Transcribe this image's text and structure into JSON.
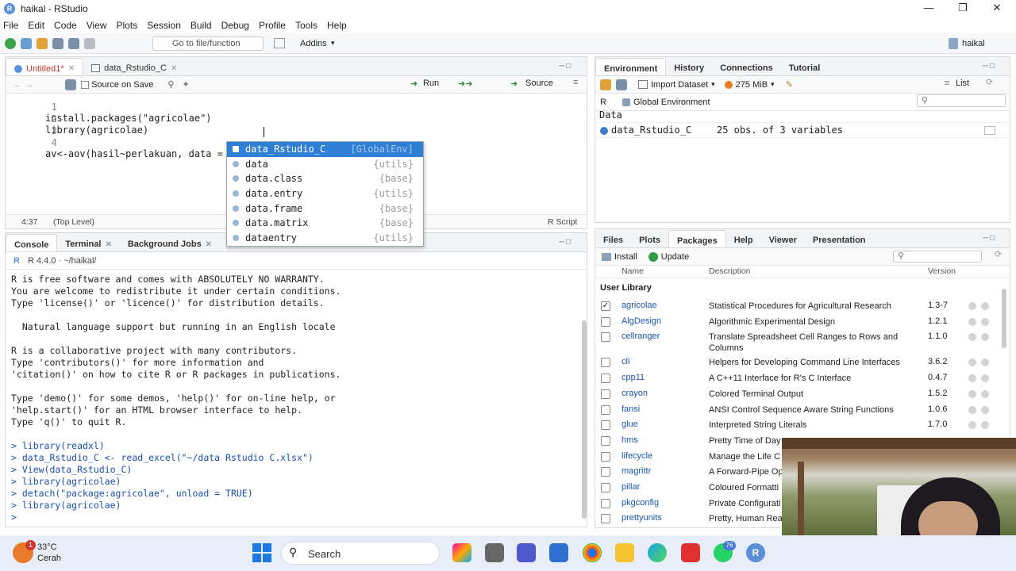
{
  "window": {
    "title": "haikal - RStudio",
    "app_icon": "R"
  },
  "menu": [
    "File",
    "Edit",
    "Code",
    "View",
    "Plots",
    "Session",
    "Build",
    "Debug",
    "Profile",
    "Tools",
    "Help"
  ],
  "toolbar": {
    "goto_placeholder": "Go to file/function",
    "addins": "Addins",
    "user": "haikal"
  },
  "editor": {
    "tabs": [
      {
        "label": "Untitled1*"
      },
      {
        "label": "data_Rstudio_C"
      }
    ],
    "source_on_save": "Source on Save",
    "run": "Run",
    "source": "Source",
    "lines": [
      {
        "num": "1",
        "text": "install.packages(\"agricolae\")"
      },
      {
        "num": "2",
        "text": "library(agricolae)"
      },
      {
        "num": "3",
        "text": ""
      },
      {
        "num": "4",
        "text": "av<-aov(hasil~perlakuan, data = data"
      }
    ],
    "status": {
      "position": "4:37",
      "scope": "(Top Level)",
      "filetype": "R Script"
    }
  },
  "autocomplete": [
    {
      "name": "data_Rstudio_C",
      "source": "[GlobalEnv]",
      "selected": true
    },
    {
      "name": "data",
      "source": "{utils}"
    },
    {
      "name": "data.class",
      "source": "{base}"
    },
    {
      "name": "data.entry",
      "source": "{utils}"
    },
    {
      "name": "data.frame",
      "source": "{base}"
    },
    {
      "name": "data.matrix",
      "source": "{base}"
    },
    {
      "name": "dataentry",
      "source": "{utils}"
    }
  ],
  "console": {
    "tabs": [
      {
        "label": "Console"
      },
      {
        "label": "Terminal"
      },
      {
        "label": "Background Jobs"
      }
    ],
    "version": "R 4.4.0 · ~/haikal/",
    "lines": [
      {
        "text": "R is free software and comes with ABSOLUTELY NO WARRANTY."
      },
      {
        "text": "You are welcome to redistribute it under certain conditions."
      },
      {
        "text": "Type 'license()' or 'licence()' for distribution details."
      },
      {
        "text": ""
      },
      {
        "text": "  Natural language support but running in an English locale"
      },
      {
        "text": ""
      },
      {
        "text": "R is a collaborative project with many contributors."
      },
      {
        "text": "Type 'contributors()' for more information and"
      },
      {
        "text": "'citation()' on how to cite R or R packages in publications."
      },
      {
        "text": ""
      },
      {
        "text": "Type 'demo()' for some demos, 'help()' for on-line help, or"
      },
      {
        "text": "'help.start()' for an HTML browser interface to help."
      },
      {
        "text": "Type 'q()' to quit R."
      },
      {
        "text": ""
      },
      {
        "text": "> library(readxl)"
      },
      {
        "text": "> data_Rstudio_C <- read_excel(\"~/data Rstudio C.xlsx\")"
      },
      {
        "text": "> View(data_Rstudio_C)"
      },
      {
        "text": "> library(agricolae)"
      },
      {
        "text": "> detach(\"package:agricolae\", unload = TRUE)"
      },
      {
        "text": "> library(agricolae)"
      },
      {
        "text": "> "
      }
    ]
  },
  "environment": {
    "tabs": [
      {
        "label": "Environment"
      },
      {
        "label": "History"
      },
      {
        "label": "Connections"
      },
      {
        "label": "Tutorial"
      }
    ],
    "import": "Import Dataset",
    "memory": "275 MiB",
    "list": "List",
    "lang": "R",
    "scope": "Global Environment",
    "section": "Data",
    "items": [
      {
        "name": "data_Rstudio_C",
        "desc": "25 obs. of 3 variables"
      }
    ]
  },
  "packages": {
    "tabs": [
      {
        "label": "Files"
      },
      {
        "label": "Plots"
      },
      {
        "label": "Packages"
      },
      {
        "label": "Help"
      },
      {
        "label": "Viewer"
      },
      {
        "label": "Presentation"
      }
    ],
    "install": "Install",
    "update": "Update",
    "headers": {
      "name": "Name",
      "desc": "Description",
      "ver": "Version"
    },
    "section": "User Library",
    "rows": [
      {
        "checked": true,
        "name": "agricolae",
        "desc": "Statistical Procedures for Agricultural Research",
        "ver": "1.3-7"
      },
      {
        "checked": false,
        "name": "AlgDesign",
        "desc": "Algorithmic Experimental Design",
        "ver": "1.2.1"
      },
      {
        "checked": false,
        "name": "cellranger",
        "desc": "Translate Spreadsheet Cell Ranges to Rows and Columns",
        "ver": "1.1.0"
      },
      {
        "checked": false,
        "name": "cli",
        "desc": "Helpers for Developing Command Line Interfaces",
        "ver": "3.6.2"
      },
      {
        "checked": false,
        "name": "cpp11",
        "desc": "A C++11 Interface for R's C Interface",
        "ver": "0.4.7"
      },
      {
        "checked": false,
        "name": "crayon",
        "desc": "Colored Terminal Output",
        "ver": "1.5.2"
      },
      {
        "checked": false,
        "name": "fansi",
        "desc": "ANSI Control Sequence Aware String Functions",
        "ver": "1.0.6"
      },
      {
        "checked": false,
        "name": "glue",
        "desc": "Interpreted String Literals",
        "ver": "1.7.0"
      },
      {
        "checked": false,
        "name": "hms",
        "desc": "Pretty Time of Day",
        "ver": ""
      },
      {
        "checked": false,
        "name": "lifecycle",
        "desc": "Manage the Life C",
        "ver": ""
      },
      {
        "checked": false,
        "name": "magrittr",
        "desc": "A Forward-Pipe Op",
        "ver": ""
      },
      {
        "checked": false,
        "name": "pillar",
        "desc": "Coloured Formatti",
        "ver": ""
      },
      {
        "checked": false,
        "name": "pkgconfig",
        "desc": "Private Configurati",
        "ver": ""
      },
      {
        "checked": false,
        "name": "prettyunits",
        "desc": "Pretty, Human Rea",
        "ver": ""
      }
    ]
  },
  "taskbar": {
    "weather_temp": "33°C",
    "weather_desc": "Cerah",
    "search": "Search",
    "badge": "1",
    "whatsapp_badge": "76"
  },
  "colors": {
    "selection": "#2f7fd6",
    "link": "#1a56b0",
    "console_cmd": "#1a4fb0"
  }
}
